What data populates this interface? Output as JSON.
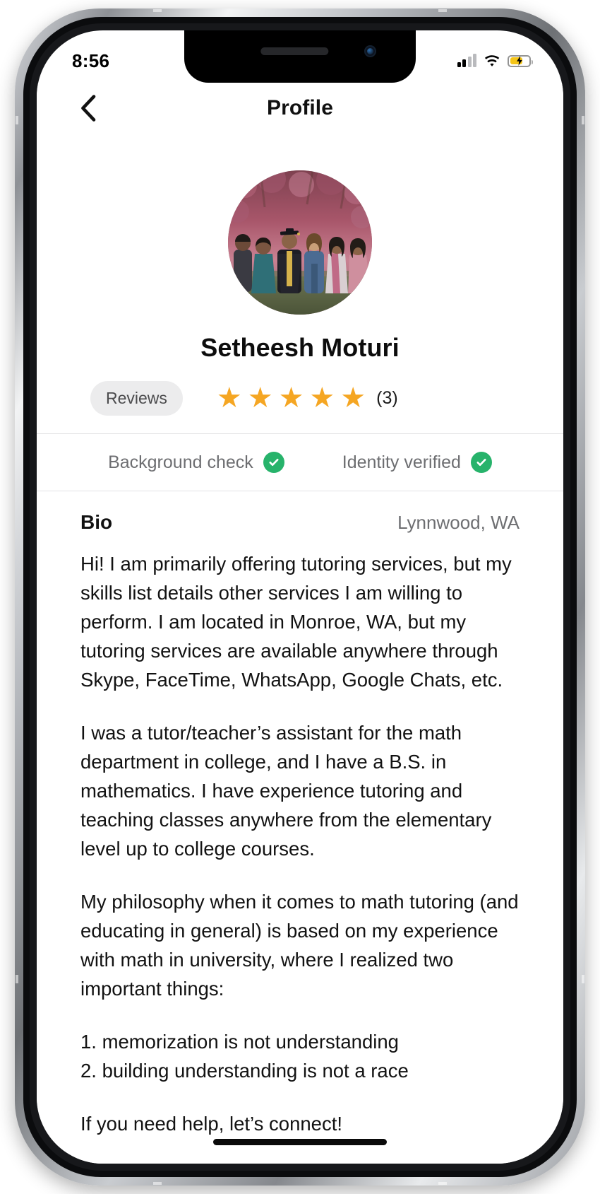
{
  "status_bar": {
    "time": "8:56",
    "signal_icon": "cellular-signal-icon",
    "wifi_icon": "wifi-icon",
    "battery_icon": "battery-charging-icon",
    "battery_color": "#f5c518"
  },
  "nav": {
    "back_icon": "chevron-left-icon",
    "title": "Profile"
  },
  "profile": {
    "avatar_alt": "group-photo-under-blossom-tree",
    "name": "Setheesh Moturi",
    "reviews_label": "Reviews",
    "rating_stars": 5,
    "star_glyph": "★",
    "star_color": "#f5a623",
    "review_count": "(3)"
  },
  "verification": {
    "background_check_label": "Background check",
    "background_check_icon": "verified-check-icon",
    "identity_label": "Identity verified",
    "identity_icon": "verified-check-icon",
    "badge_color": "#27b36b"
  },
  "bio": {
    "title": "Bio",
    "location": "Lynnwood, WA",
    "paragraphs": [
      "Hi! I am primarily offering tutoring services, but my skills list details other services I am willing to perform. I am located in Monroe, WA, but my tutoring services are available anywhere through Skype, FaceTime, WhatsApp, Google Chats, etc.",
      "I was a tutor/teacher’s assistant for the math department in college, and I have a B.S. in mathematics. I have experience tutoring and teaching classes anywhere from the elementary level up to college courses.",
      "My philosophy when it comes to math tutoring (and educating in general) is based on my experience with math in university, where I realized two important things:",
      "1. memorization is not understanding\n2. building understanding is not a race",
      "If you need help, let’s connect!"
    ]
  },
  "home_indicator": "home-indicator"
}
